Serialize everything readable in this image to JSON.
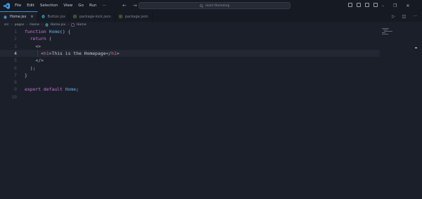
{
  "menu": [
    "File",
    "Edit",
    "Selection",
    "View",
    "Go",
    "Run",
    "···"
  ],
  "search": {
    "placeholder": "react themeing"
  },
  "tabs": [
    {
      "label": "Home.jsx",
      "icon": "react-icon",
      "active": true,
      "close": "×"
    },
    {
      "label": "Button.jsx",
      "icon": "react-icon",
      "active": false
    },
    {
      "label": "package-lock.json",
      "icon": "json-icon",
      "active": false
    },
    {
      "label": "package.json",
      "icon": "json-icon",
      "active": false
    }
  ],
  "breadcrumb": [
    "src",
    "pages",
    "Home",
    "Home.jsx",
    "Home"
  ],
  "editor": {
    "current_line": 4,
    "lines": [
      {
        "n": "1",
        "tokens": [
          [
            "kw",
            "function "
          ],
          [
            "fn",
            "Home"
          ],
          [
            "pn",
            "() {"
          ]
        ]
      },
      {
        "n": "2",
        "tokens": [
          [
            "kw",
            "  return "
          ],
          [
            "pn",
            "("
          ]
        ]
      },
      {
        "n": "3",
        "tokens": [
          [
            "pn",
            "    <>"
          ]
        ]
      },
      {
        "n": "4",
        "tokens": [
          [
            "pn",
            "      <"
          ],
          [
            "tag",
            "h1"
          ],
          [
            "pn",
            ">"
          ],
          [
            "txt",
            "This is the Homepage"
          ],
          [
            "pn",
            "</"
          ],
          [
            "tag",
            "h1"
          ],
          [
            "pn",
            ">"
          ]
        ]
      },
      {
        "n": "5",
        "tokens": [
          [
            "pn",
            "    </>"
          ]
        ]
      },
      {
        "n": "6",
        "tokens": [
          [
            "pn",
            "  );"
          ]
        ]
      },
      {
        "n": "7",
        "tokens": [
          [
            "pn",
            "}"
          ]
        ]
      },
      {
        "n": "8",
        "tokens": []
      },
      {
        "n": "9",
        "tokens": [
          [
            "kw",
            "export default "
          ],
          [
            "fn",
            "Home"
          ],
          [
            "pn",
            ";"
          ]
        ]
      },
      {
        "n": "10",
        "tokens": []
      }
    ]
  },
  "colors": {
    "accent": "#3f8fd8",
    "keyword": "#c678dd",
    "function": "#61afef",
    "tag": "#e06c75",
    "background": "#1b1f29"
  }
}
